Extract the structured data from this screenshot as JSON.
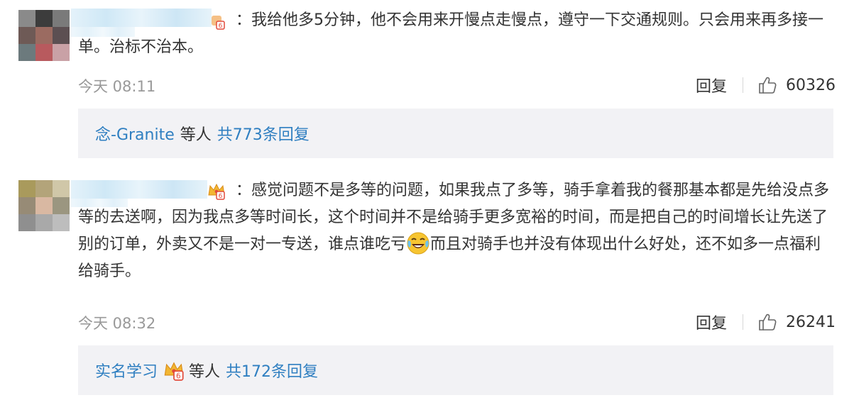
{
  "comments": [
    {
      "text_after_name": "：我给他多5分钟，他不会用来开慢点走慢点，遵守一下交通规则。只会用来再多接一单。治标不治本。",
      "time": "今天 08:11",
      "reply_label": "回复",
      "likes": "60326",
      "replies": {
        "first_name": "念-Granite",
        "etc_label": "等人",
        "total_label": "共773条回复"
      }
    },
    {
      "text_part1": "：感觉问题不是多等的问题，如果我点了多等，骑手拿着我的餐那基本都是先给没点多等的去送啊，因为我点多等时间长，这个时间并不是给骑手更多宽裕的时间，而是把自己的时间增长让先送了别的订单，外卖又不是一对一专送，谁点谁吃亏",
      "emoji_name": "laughing-crying-emoji",
      "text_part2": "而且对骑手也并没有体现出什么好处，还不如多一点福利给骑手。",
      "time": "今天 08:32",
      "reply_label": "回复",
      "likes": "26241",
      "replies": {
        "first_name": "实名学习",
        "etc_label": "等人",
        "total_label": "共172条回复"
      }
    }
  ],
  "colors": {
    "link": "#2f7fc1",
    "reply_box_bg": "#f2f2f5",
    "meta_text": "#999999"
  }
}
